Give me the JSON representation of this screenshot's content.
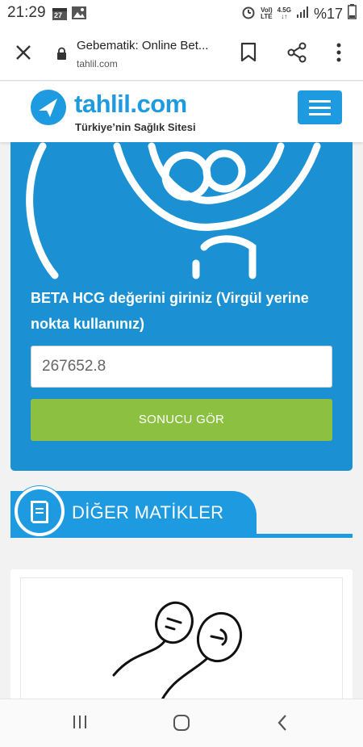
{
  "status_bar": {
    "time": "21:29",
    "calendar_day": "27",
    "volte_top": "Vol)",
    "volte_bottom": "LTE",
    "net_top": "4.5G",
    "battery": "%17"
  },
  "browser": {
    "page_title": "Gebematik: Online Bet...",
    "url": "tahlil.com"
  },
  "site": {
    "logo_name": "tahlil.com",
    "tagline": "Türkiye’nin Sağlık Sitesi",
    "brand_color": "#1e9be0"
  },
  "calculator": {
    "prompt": "BETA HCG değerini giriniz (Virgül yerine nokta kullanınız)",
    "input_value": "267652.8",
    "submit_label": "SONUCU GÖR",
    "button_color": "#8bc040"
  },
  "other": {
    "heading": "DİĞER MATİKLER"
  }
}
